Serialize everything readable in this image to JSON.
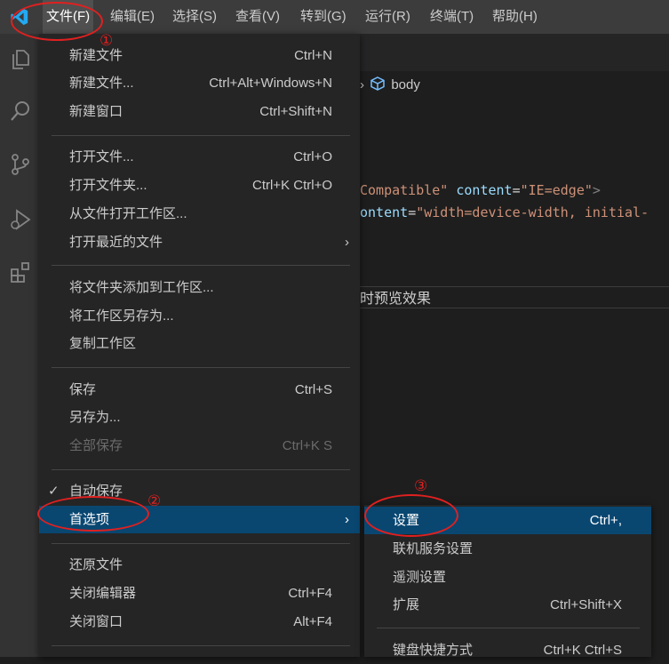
{
  "menubar": {
    "items": [
      "文件(F)",
      "编辑(E)",
      "选择(S)",
      "查看(V)",
      "转到(G)",
      "运行(R)",
      "终端(T)",
      "帮助(H)"
    ]
  },
  "activity_icons": [
    "explorer-icon",
    "search-icon",
    "source-control-icon",
    "run-debug-icon",
    "extensions-icon"
  ],
  "editor": {
    "breadcrumb": "body",
    "code_line1": [
      "Compatible\"",
      "content",
      "=",
      "\"IE=edge\"",
      ">"
    ],
    "code_line2": [
      "ontent",
      "=",
      "\"width=device-width, initial-"
    ],
    "preview_text": "时预览效果"
  },
  "file_menu": {
    "new_file": {
      "label": "新建文件",
      "key": "Ctrl+N"
    },
    "new_file_ellipsis": {
      "label": "新建文件...",
      "key": "Ctrl+Alt+Windows+N"
    },
    "new_window": {
      "label": "新建窗口",
      "key": "Ctrl+Shift+N"
    },
    "open_file": {
      "label": "打开文件...",
      "key": "Ctrl+O"
    },
    "open_folder": {
      "label": "打开文件夹...",
      "key": "Ctrl+K Ctrl+O"
    },
    "open_workspace": {
      "label": "从文件打开工作区..."
    },
    "open_recent": {
      "label": "打开最近的文件"
    },
    "add_folder": {
      "label": "将文件夹添加到工作区..."
    },
    "save_workspace_as": {
      "label": "将工作区另存为..."
    },
    "duplicate_workspace": {
      "label": "复制工作区"
    },
    "save": {
      "label": "保存",
      "key": "Ctrl+S"
    },
    "save_as": {
      "label": "另存为..."
    },
    "save_all": {
      "label": "全部保存",
      "key": "Ctrl+K S"
    },
    "auto_save": {
      "label": "自动保存"
    },
    "preferences": {
      "label": "首选项"
    },
    "revert": {
      "label": "还原文件"
    },
    "close_editor": {
      "label": "关闭编辑器",
      "key": "Ctrl+F4"
    },
    "close_window": {
      "label": "关闭窗口",
      "key": "Alt+F4"
    }
  },
  "preferences_submenu": {
    "settings": {
      "label": "设置",
      "key": "Ctrl+,"
    },
    "online_settings": {
      "label": "联机服务设置"
    },
    "telemetry": {
      "label": "遥测设置"
    },
    "extensions": {
      "label": "扩展",
      "key": "Ctrl+Shift+X"
    },
    "keybindings": {
      "label": "键盘快捷方式",
      "key": "Ctrl+K Ctrl+S"
    }
  },
  "annotations": [
    "①",
    "②",
    "③"
  ],
  "colors": {
    "selected_bg": "#094771",
    "annotation": "#e02020",
    "menu_bg": "#252526"
  }
}
